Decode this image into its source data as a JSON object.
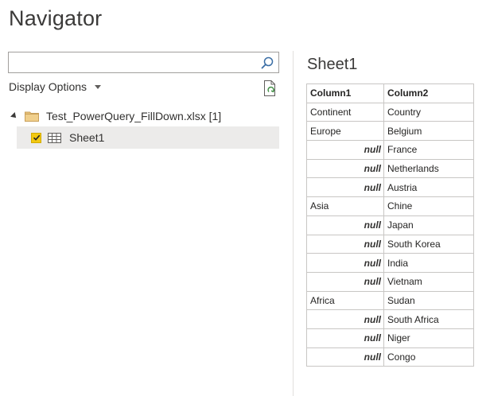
{
  "navigator": {
    "title": "Navigator",
    "search": {
      "value": "",
      "placeholder": "",
      "icon": "search-icon"
    },
    "display_options": {
      "label": "Display Options",
      "icon": "chevron-down-icon"
    },
    "refresh": {
      "icon": "refresh-icon"
    },
    "tree": {
      "file": {
        "label": "Test_PowerQuery_FillDown.xlsx [1]",
        "icon": "folder-icon",
        "expanded": true
      },
      "sheet": {
        "label": "Sheet1",
        "icon": "table-icon",
        "checked": true,
        "accent": "#f2c811"
      }
    }
  },
  "preview": {
    "title": "Sheet1",
    "headers": [
      "Column1",
      "Column2"
    ],
    "rows": [
      [
        "Continent",
        "Country"
      ],
      [
        "Europe",
        "Belgium"
      ],
      [
        "null",
        "France"
      ],
      [
        "null",
        "Netherlands"
      ],
      [
        "null",
        "Austria"
      ],
      [
        "Asia",
        "Chine"
      ],
      [
        "null",
        "Japan"
      ],
      [
        "null",
        "South Korea"
      ],
      [
        "null",
        "India"
      ],
      [
        "null",
        "Vietnam"
      ],
      [
        "Africa",
        "Sudan"
      ],
      [
        "null",
        "South Africa"
      ],
      [
        "null",
        "Niger"
      ],
      [
        "null",
        "Congo"
      ]
    ]
  }
}
